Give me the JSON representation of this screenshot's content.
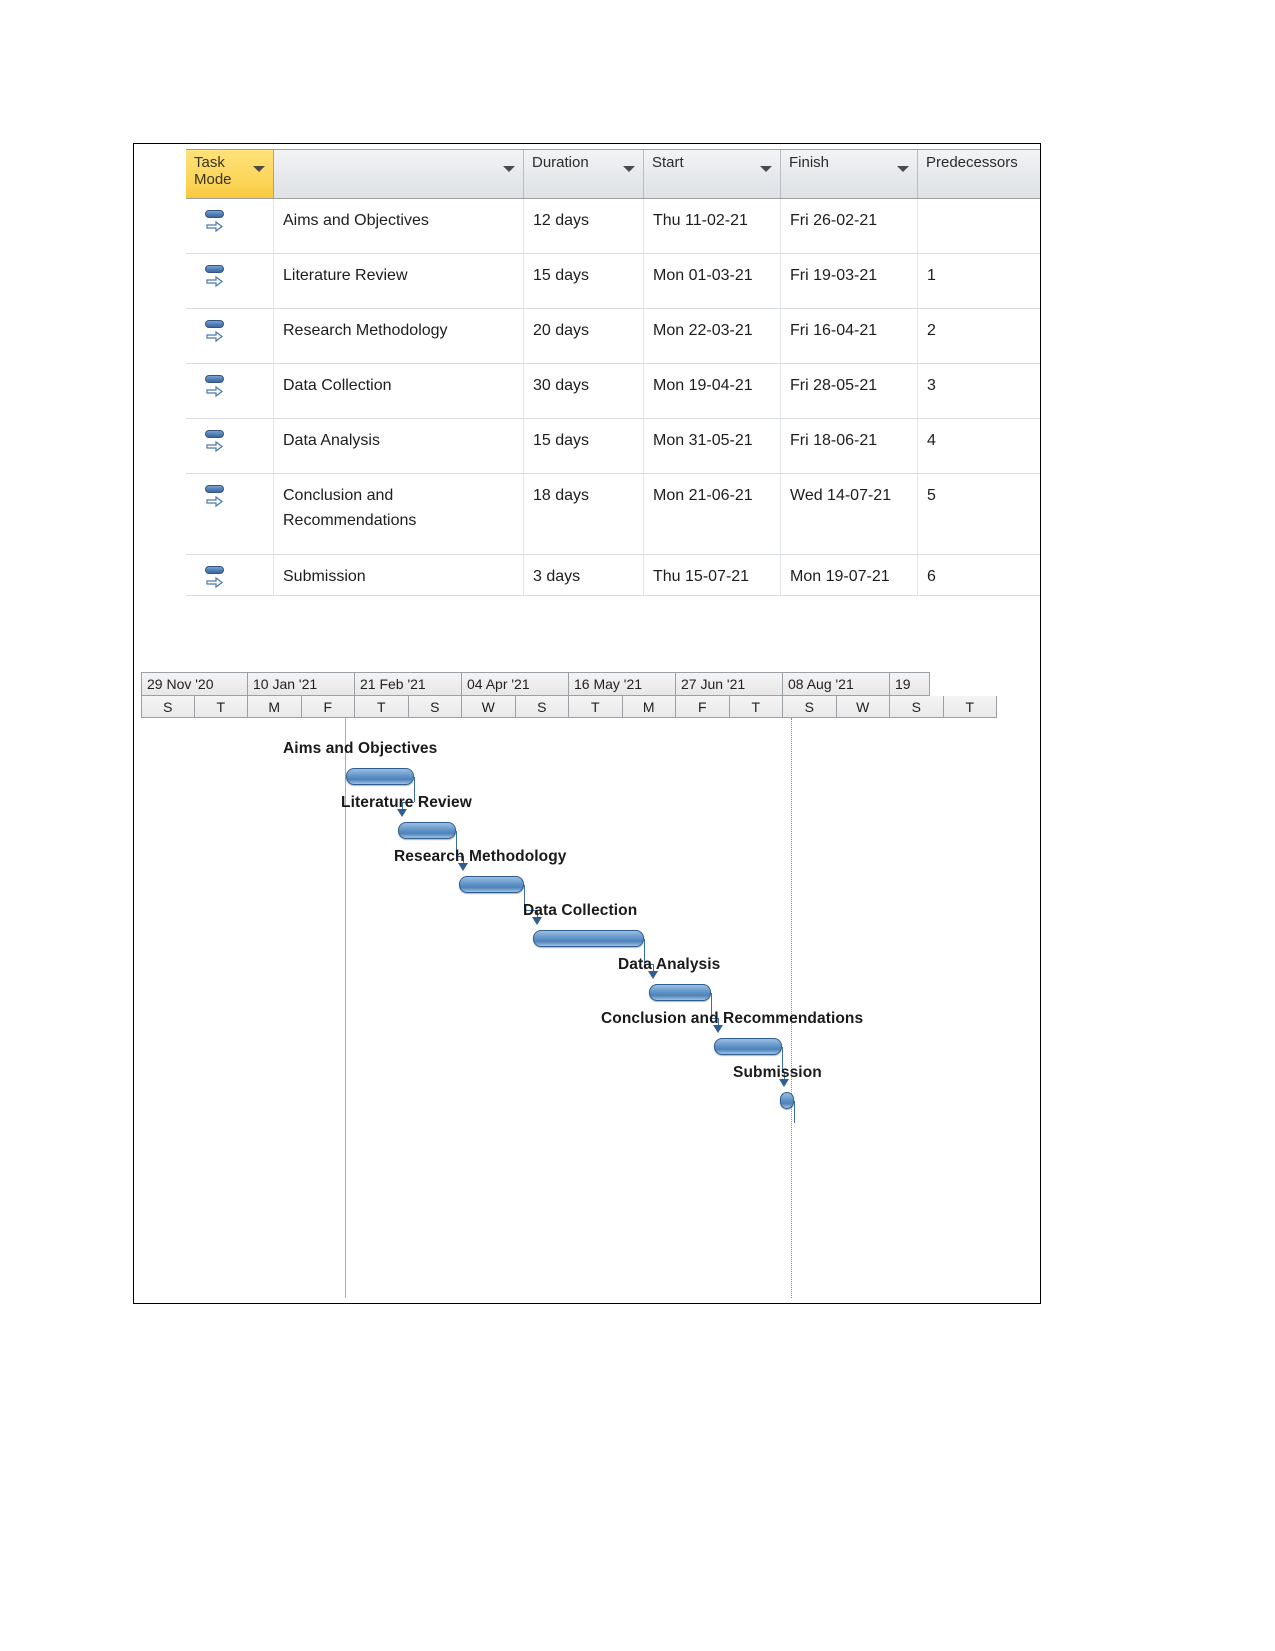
{
  "table": {
    "columns": [
      {
        "key": "mode",
        "label": "Task\nMode",
        "label_line1": "Task",
        "label_line2": "Mode"
      },
      {
        "key": "name",
        "label": ""
      },
      {
        "key": "duration",
        "label": "Duration"
      },
      {
        "key": "start",
        "label": "Start"
      },
      {
        "key": "finish",
        "label": "Finish"
      },
      {
        "key": "predecessors",
        "label": "Predecessors"
      }
    ],
    "header": {
      "task_mode_line1": "Task",
      "task_mode_line2": "Mode",
      "name": "",
      "duration": "Duration",
      "start": "Start",
      "finish": "Finish",
      "predecessors": "Predecessors"
    },
    "rows": [
      {
        "mode_icon": "auto-schedule-icon",
        "name": "Aims and Objectives",
        "duration": "12 days",
        "start": "Thu 11-02-21",
        "finish": "Fri 26-02-21",
        "predecessors": ""
      },
      {
        "mode_icon": "auto-schedule-icon",
        "name": "Literature Review",
        "duration": "15 days",
        "start": "Mon 01-03-21",
        "finish": "Fri 19-03-21",
        "predecessors": "1"
      },
      {
        "mode_icon": "auto-schedule-icon",
        "name": "Research Methodology",
        "duration": "20 days",
        "start": "Mon 22-03-21",
        "finish": "Fri 16-04-21",
        "predecessors": "2"
      },
      {
        "mode_icon": "auto-schedule-icon",
        "name": "Data Collection",
        "duration": "30 days",
        "start": "Mon 19-04-21",
        "finish": "Fri 28-05-21",
        "predecessors": "3"
      },
      {
        "mode_icon": "auto-schedule-icon",
        "name": "Data Analysis",
        "duration": "15 days",
        "start": "Mon 31-05-21",
        "finish": "Fri 18-06-21",
        "predecessors": "4"
      },
      {
        "mode_icon": "auto-schedule-icon",
        "name": "Conclusion and Recommendations",
        "duration": "18 days",
        "start": "Mon 21-06-21",
        "finish": "Wed 14-07-21",
        "predecessors": "5"
      },
      {
        "mode_icon": "auto-schedule-icon",
        "name": "Submission",
        "duration": "3 days",
        "start": "Thu 15-07-21",
        "finish": "Mon 19-07-21",
        "predecessors": "6"
      }
    ]
  },
  "gantt": {
    "timeline": {
      "major_ticks": [
        "29 Nov '20",
        "10 Jan '21",
        "21 Feb '21",
        "04 Apr '21",
        "16 May '21",
        "27 Jun '21",
        "08 Aug '21",
        "19"
      ],
      "minor_ticks": [
        "S",
        "T",
        "M",
        "F",
        "T",
        "S",
        "W",
        "S",
        "T",
        "M",
        "F",
        "T",
        "S",
        "W",
        "S",
        "T"
      ]
    },
    "bars": [
      {
        "label": "Aims and Objectives",
        "duration": "12 days",
        "start": "Thu 11-02-21",
        "finish": "Fri 26-02-21"
      },
      {
        "label": "Literature Review",
        "duration": "15 days",
        "start": "Mon 01-03-21",
        "finish": "Fri 19-03-21"
      },
      {
        "label": "Research Methodology",
        "duration": "20 days",
        "start": "Mon 22-03-21",
        "finish": "Fri 16-04-21"
      },
      {
        "label": "Data Collection",
        "duration": "30 days",
        "start": "Mon 19-04-21",
        "finish": "Fri 28-05-21"
      },
      {
        "label": "Data Analysis",
        "duration": "15 days",
        "start": "Mon 31-05-21",
        "finish": "Fri 18-06-21"
      },
      {
        "label": "Conclusion and Recommendations",
        "duration": "18 days",
        "start": "Mon 21-06-21",
        "finish": "Wed 14-07-21"
      },
      {
        "label": "Submission",
        "duration": "3 days",
        "start": "Thu 15-07-21",
        "finish": "Mon 19-07-21"
      }
    ]
  },
  "colors": {
    "bar_fill": "#5b8fc4",
    "bar_border": "#2f5d8f",
    "task_mode_header": "#fcd65c",
    "header_gray": "#e8eaec",
    "today_line": "#e8a33d",
    "status_line": "#8c8c8c",
    "link_line": "#3a6ea5"
  }
}
